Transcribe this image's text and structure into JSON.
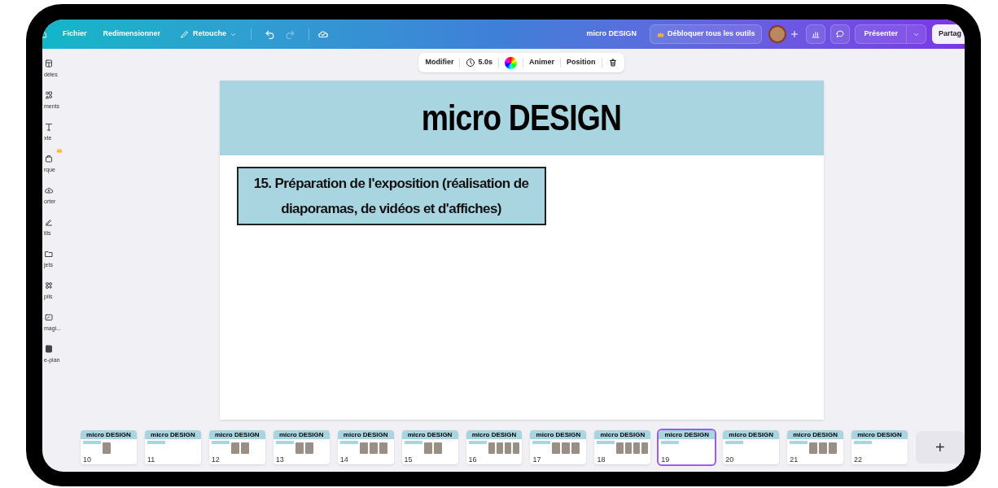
{
  "topbar": {
    "menu": [
      "Fichier",
      "Redimensionner"
    ],
    "edit_menu": "Retouche",
    "history": [
      {
        "kind": "undo",
        "disabled": false
      },
      {
        "kind": "redo",
        "disabled": true
      }
    ],
    "title": "micro DESIGN",
    "upgrade_button": "Débloquer tous les outils",
    "present_button": "Présenter",
    "share_button": "Partag"
  },
  "sidebar": {
    "items": [
      {
        "kind": "templates",
        "label": "dèles",
        "premium": false
      },
      {
        "kind": "elements",
        "label": "ments",
        "premium": false
      },
      {
        "kind": "text",
        "label": "xte",
        "premium": false
      },
      {
        "kind": "brand",
        "label": "rque",
        "premium": true
      },
      {
        "kind": "upload",
        "label": "orter",
        "premium": false
      },
      {
        "kind": "draw",
        "label": "tils",
        "premium": false
      },
      {
        "kind": "projects",
        "label": "jets",
        "premium": false
      },
      {
        "kind": "apps",
        "label": "pils",
        "premium": false
      },
      {
        "kind": "magic",
        "label": "magi...",
        "premium": false
      },
      {
        "kind": "background",
        "label": "e-plan",
        "premium": false
      }
    ]
  },
  "context_toolbar": {
    "modify": "Modifier",
    "duration": "5.0s",
    "animate": "Animer",
    "position": "Position"
  },
  "slide": {
    "title": "micro DESIGN",
    "text_box": "15. Préparation de l'exposition (réalisation de diaporamas, de vidéos et d'affiches)"
  },
  "pages": [
    {
      "number": "10",
      "title": "micro DESIGN",
      "selected": false
    },
    {
      "number": "11",
      "title": "micro DESIGN",
      "selected": false
    },
    {
      "number": "12",
      "title": "micro DESIGN",
      "selected": false
    },
    {
      "number": "13",
      "title": "micro DESIGN",
      "selected": false
    },
    {
      "number": "14",
      "title": "micro DESIGN",
      "selected": false
    },
    {
      "number": "15",
      "title": "micro DESIGN",
      "selected": false
    },
    {
      "number": "16",
      "title": "micro DESIGN",
      "selected": false
    },
    {
      "number": "17",
      "title": "micro DESIGN",
      "selected": false
    },
    {
      "number": "18",
      "title": "micro DESIGN",
      "selected": false
    },
    {
      "number": "19",
      "title": "micro DESIGN",
      "selected": true
    },
    {
      "number": "20",
      "title": "micro DESIGN",
      "selected": false
    },
    {
      "number": "21",
      "title": "micro DESIGN",
      "selected": false
    },
    {
      "number": "22",
      "title": "micro DESIGN",
      "selected": false
    }
  ],
  "add_page_button": "+"
}
